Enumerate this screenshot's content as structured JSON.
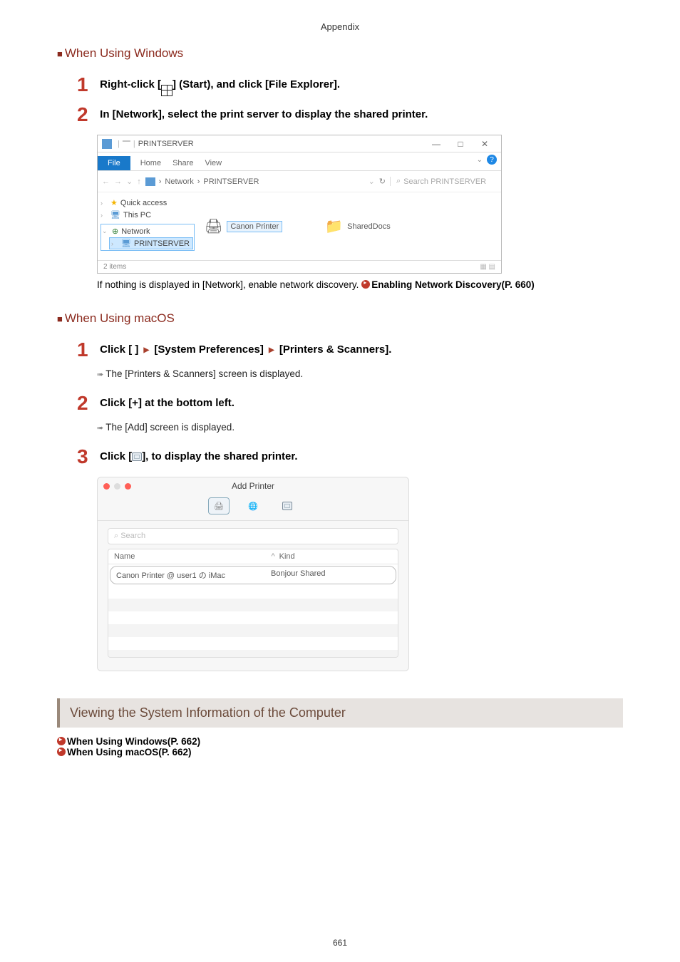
{
  "header": "Appendix",
  "page_number": "661",
  "sec_windows": {
    "title": "When Using Windows",
    "step1_pre": "Right-click [",
    "step1_post": "] (Start), and click [File Explorer].",
    "step2": "In [Network], select the print server to display the shared printer.",
    "note_pre": "If nothing is displayed in [Network], enable network discovery. ",
    "note_link": "Enabling Network Discovery(P. 660)"
  },
  "win_shot": {
    "title": "PRINTSERVER",
    "ribbon": {
      "file": "File",
      "home": "Home",
      "share": "Share",
      "view": "View"
    },
    "path": {
      "network": "Network",
      "server": "PRINTSERVER"
    },
    "refresh_label": "",
    "search_placeholder": "Search PRINTSERVER",
    "tree": {
      "quick": "Quick access",
      "thispc": "This PC",
      "network": "Network",
      "server": "PRINTSERVER"
    },
    "items": {
      "printer": "Canon Printer",
      "shared": "SharedDocs"
    },
    "status": "2 items"
  },
  "sec_macos": {
    "title": "When Using macOS",
    "step1_pre": "Click [ ",
    "step1_syspref": " [System Preferences] ",
    "step1_printers": " [Printers & Scanners].",
    "step1_desc": "The [Printers & Scanners] screen is displayed.",
    "step2": "Click [+] at the bottom left.",
    "step2_desc": "The [Add] screen is displayed.",
    "step3_pre": "Click [",
    "step3_post": "], to display the shared printer."
  },
  "mac_shot": {
    "title": "Add Printer",
    "search_placeholder": "Search",
    "col_name": "Name",
    "col_kind": "Kind",
    "row_name": "Canon Printer @ user1 の iMac",
    "row_kind": "Bonjour Shared"
  },
  "band": {
    "title": "Viewing the System Information of the Computer",
    "link1": "When Using Windows(P. 662)",
    "link2": "When Using macOS(P. 662)"
  }
}
